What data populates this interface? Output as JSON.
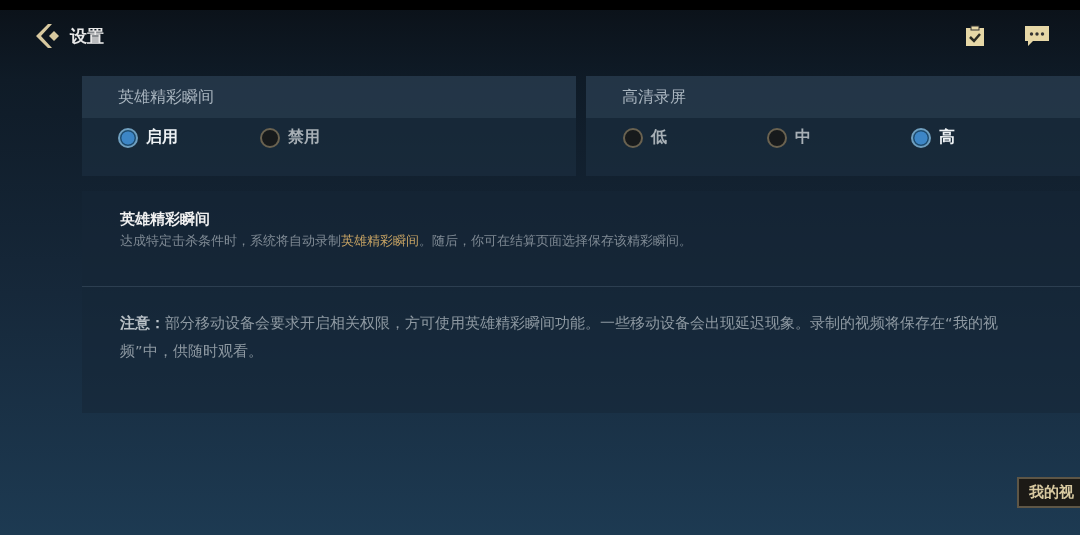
{
  "header": {
    "title": "设置"
  },
  "groups": [
    {
      "title": "英雄精彩瞬间",
      "options": [
        {
          "label": "启用",
          "selected": true
        },
        {
          "label": "禁用",
          "selected": false
        }
      ]
    },
    {
      "title": "高清录屏",
      "options": [
        {
          "label": "低",
          "selected": false
        },
        {
          "label": "中",
          "selected": false
        },
        {
          "label": "高",
          "selected": true
        }
      ]
    }
  ],
  "info": {
    "title": "英雄精彩瞬间",
    "description": [
      {
        "text": "达成特定击杀条件时，系统将自动录制",
        "highlight": false
      },
      {
        "text": "英雄精彩瞬间",
        "highlight": true
      },
      {
        "text": "。随后，你可在结算页面选择保存该精彩瞬间。",
        "highlight": false
      }
    ],
    "note": "**注意：**部分移动设备会要求开启相关权限，方可使用英雄精彩瞬间功能。一些移动设备会出现延迟现象。录制的视频将保存在“我的视频”中，供随时观看。"
  },
  "corner_button": {
    "label": "我的视"
  }
}
